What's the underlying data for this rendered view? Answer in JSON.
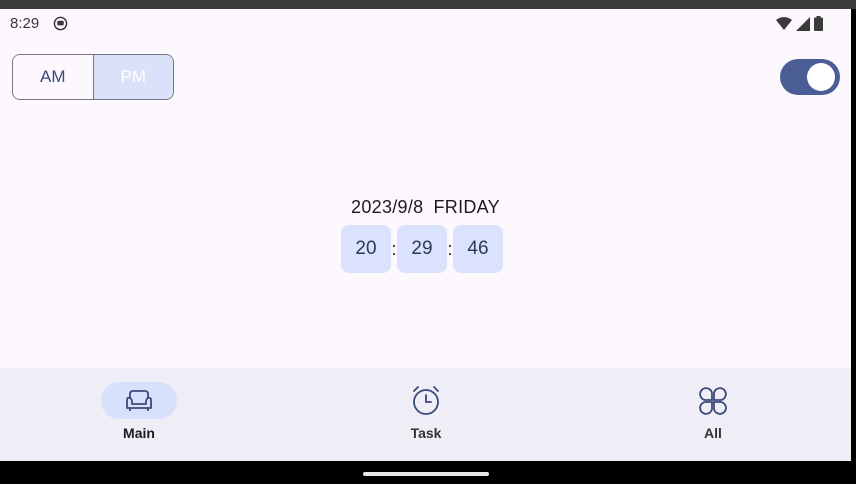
{
  "status_bar": {
    "time": "8:29",
    "notification_icon": "android-debug-icon",
    "wifi_icon": "wifi-icon",
    "signal_icon": "cell-signal-icon",
    "battery_icon": "battery-icon"
  },
  "ampm": {
    "am_label": "AM",
    "pm_label": "PM",
    "selected": "PM"
  },
  "toggle": {
    "on": true
  },
  "clock": {
    "date": "2023/9/8",
    "weekday": "FRIDAY",
    "hours": "20",
    "minutes": "29",
    "seconds": "46",
    "separator": ":"
  },
  "nav": {
    "items": [
      {
        "label": "Main",
        "icon": "sofa-icon",
        "active": true
      },
      {
        "label": "Task",
        "icon": "alarm-clock-icon",
        "active": false
      },
      {
        "label": "All",
        "icon": "clover-grid-icon",
        "active": false
      }
    ]
  },
  "colors": {
    "accent": "#4a5e95",
    "pill_bg": "#dae2fc",
    "nav_bg": "#efedf6",
    "screen_bg": "#fdf8fd"
  }
}
